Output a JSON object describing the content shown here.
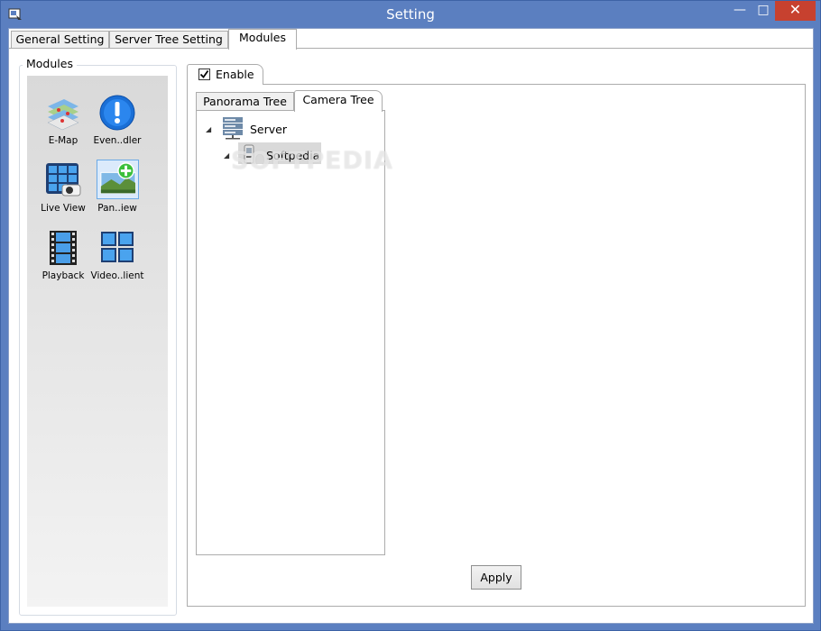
{
  "window": {
    "title": "Setting",
    "minimize": "—",
    "maximize": "□",
    "close": "✕"
  },
  "tabs": [
    {
      "label": "General Setting"
    },
    {
      "label": "Server Tree Setting"
    },
    {
      "label": "Modules"
    }
  ],
  "modules_group": {
    "caption": "Modules",
    "items": [
      {
        "label": "E-Map",
        "icon": "map-icon"
      },
      {
        "label": "Even..dler",
        "icon": "event-handler-icon"
      },
      {
        "label": "Live View",
        "icon": "live-view-icon"
      },
      {
        "label": "Pan..iew",
        "icon": "panorama-view-icon",
        "selected": true
      },
      {
        "label": "Playback",
        "icon": "playback-icon"
      },
      {
        "label": "Video..lient",
        "icon": "video-client-icon"
      }
    ]
  },
  "enable": {
    "label": "Enable",
    "checked": true
  },
  "inner_tabs": [
    {
      "label": "Panorama Tree"
    },
    {
      "label": "Camera Tree"
    }
  ],
  "tree": {
    "root": {
      "label": "Server",
      "icon": "server-icon"
    },
    "child": {
      "label": "Softpedia",
      "icon": "device-icon"
    },
    "watermark": "SOFTPEDIA"
  },
  "apply_label": "Apply",
  "colors": {
    "titlebar": "#5b7fc0",
    "close": "#c7412f",
    "selection": "#d9d9d9"
  }
}
